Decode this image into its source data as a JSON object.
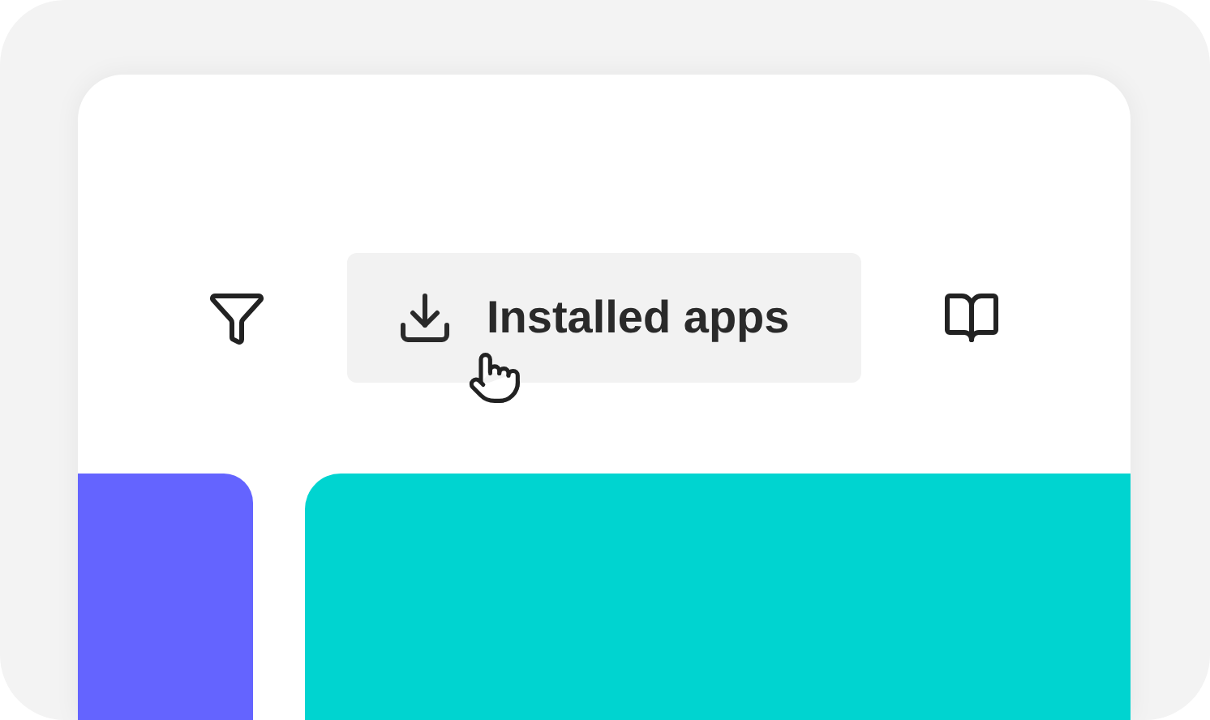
{
  "toolbar": {
    "button": {
      "label": "Installed apps"
    }
  }
}
